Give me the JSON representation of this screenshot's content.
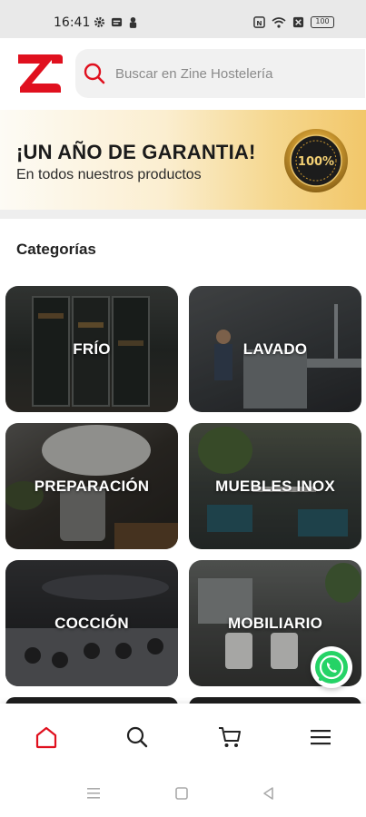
{
  "status_bar": {
    "time": "16:41",
    "battery": "100"
  },
  "header": {
    "logo_icon": "zine-logo-icon",
    "search": {
      "placeholder": "Buscar en Zine Hostelería",
      "value": "",
      "icon": "search-icon"
    }
  },
  "banner": {
    "title": "¡UN AÑO DE GARANTIA!",
    "subtitle": "En todos nuestros productos",
    "badge_text": "100%",
    "badge_icon": "guarantee-seal-icon"
  },
  "categories": {
    "title": "Categorías",
    "items": [
      {
        "label": "FRÍO"
      },
      {
        "label": "LAVADO"
      },
      {
        "label": "PREPARACIÓN"
      },
      {
        "label": "MUEBLES INOX"
      },
      {
        "label": "COCCIÓN"
      },
      {
        "label": "MOBILIARIO"
      }
    ]
  },
  "bottom_nav": {
    "items": [
      {
        "icon": "home-icon",
        "active": true
      },
      {
        "icon": "search-icon",
        "active": false
      },
      {
        "icon": "cart-icon",
        "active": false
      },
      {
        "icon": "menu-icon",
        "active": false
      }
    ]
  },
  "colors": {
    "brand_red": "#e0101e",
    "whatsapp_green": "#25d366"
  }
}
